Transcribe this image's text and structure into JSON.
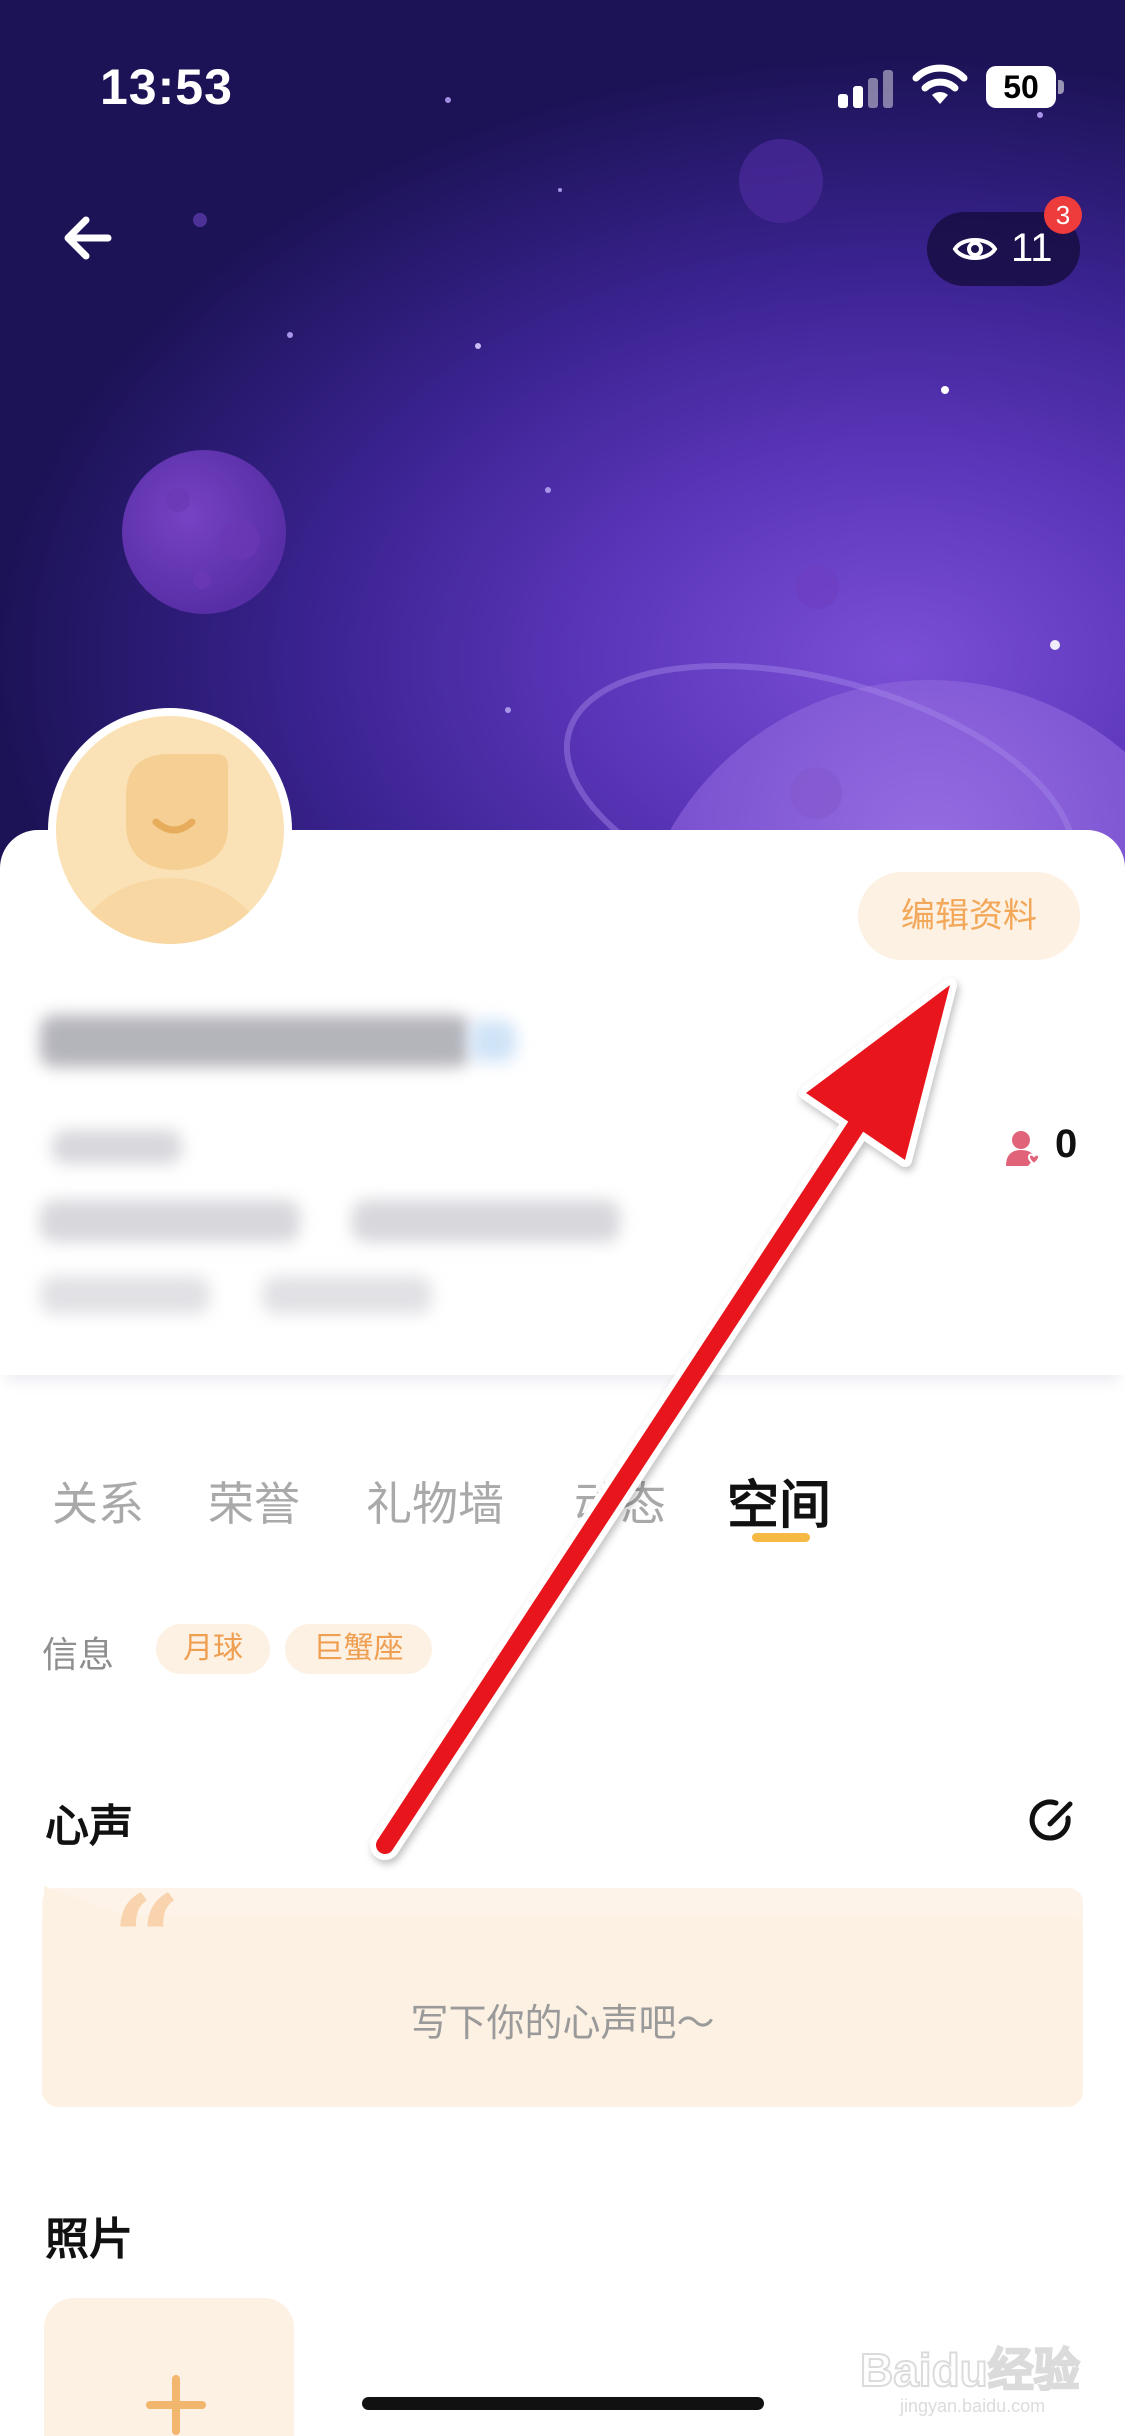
{
  "status_bar": {
    "time": "13:53",
    "battery": "50"
  },
  "header": {
    "visitors_count": "11",
    "visitors_badge": "3"
  },
  "profile": {
    "edit_button_label": "编辑资料",
    "fans_count": "0"
  },
  "tabs": [
    {
      "label": "关系",
      "active": false
    },
    {
      "label": "荣誉",
      "active": false
    },
    {
      "label": "礼物墙",
      "active": false
    },
    {
      "label": "动态",
      "active": false
    },
    {
      "label": "空间",
      "active": true
    }
  ],
  "info": {
    "label": "信息",
    "tags": [
      "月球",
      "巨蟹座"
    ]
  },
  "voice": {
    "title": "心声",
    "placeholder": "写下你的心声吧～"
  },
  "photos": {
    "title": "照片"
  },
  "watermark": {
    "brand": "Baidu经验",
    "url": "jingyan.baidu.com"
  },
  "colors": {
    "accent": "#F3A758",
    "tab_indicator": "#F5B944",
    "annotation_arrow": "#E8141B",
    "header_purple": "#5A35B8"
  }
}
